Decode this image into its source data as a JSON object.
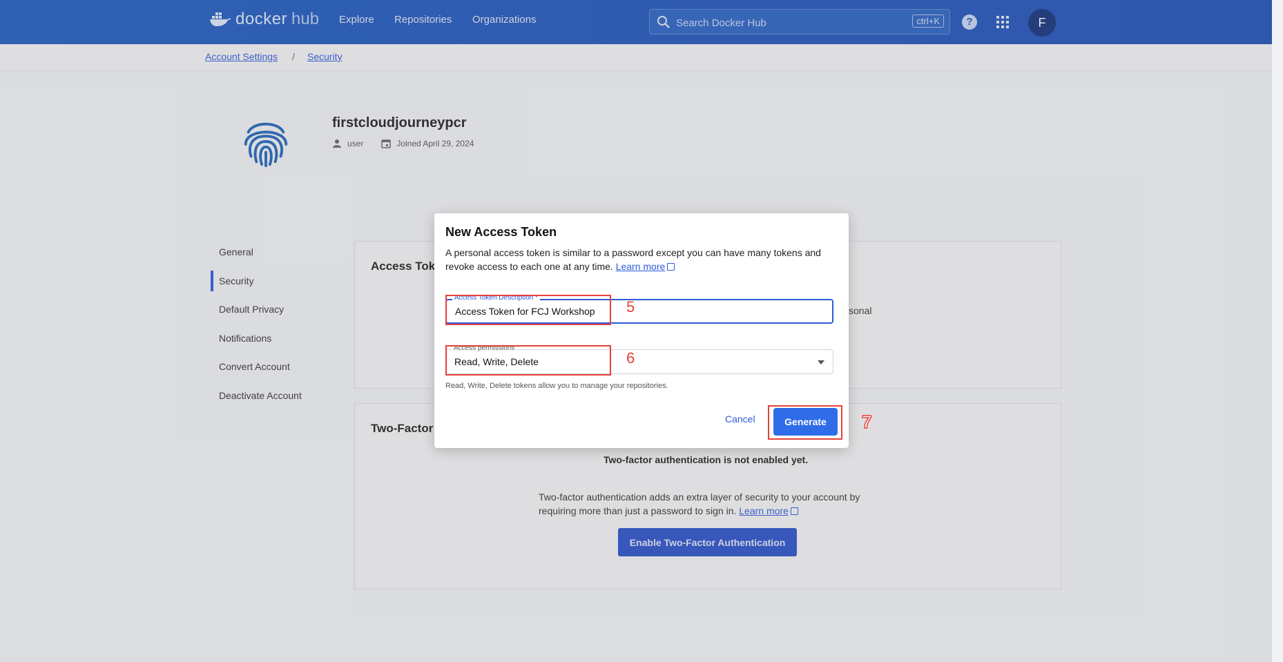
{
  "nav": {
    "brand": "docker",
    "brand_suffix": "hub",
    "links": [
      "Explore",
      "Repositories",
      "Organizations"
    ],
    "search_placeholder": "Search Docker Hub",
    "search_shortcut": "ctrl+K",
    "help_glyph": "?",
    "avatar_initial": "F"
  },
  "breadcrumb": {
    "items": [
      "Account Settings",
      "Security"
    ],
    "separator": "/"
  },
  "profile": {
    "username": "firstcloudjourneypcr",
    "role": "user",
    "joined": "Joined April 29, 2024"
  },
  "sidebar": {
    "items": [
      "General",
      "Security",
      "Default Privacy",
      "Notifications",
      "Convert Account",
      "Deactivate Account"
    ],
    "active": "Security"
  },
  "cards": {
    "access_tokens_title": "Access Toke",
    "access_tokens_partial": "sonal",
    "twofa_title": "Two-Factor",
    "twofa_status": "Two-factor authentication is not enabled yet.",
    "twofa_desc": "Two-factor authentication adds an extra layer of security to your account by requiring more than just a password to sign in.",
    "learn_more": "Learn more",
    "enable_button": "Enable Two-Factor Authentication"
  },
  "modal": {
    "title": "New Access Token",
    "description": "A personal access token is similar to a password except you can have many tokens and revoke access to each one at any time.",
    "learn_more": "Learn more",
    "desc_label": "Access Token Description *",
    "desc_value": "Access Token for FCJ Workshop",
    "perm_label": "Access permissions",
    "perm_value": "Read, Write, Delete",
    "perm_help": "Read, Write, Delete tokens allow you to manage your repositories.",
    "cancel": "Cancel",
    "generate": "Generate"
  },
  "annotations": {
    "a5": "5",
    "a6": "6",
    "a7": "7",
    "color": "#e8403a"
  },
  "colors": {
    "topbar": "#1f55bc",
    "primary": "#2f6ce8",
    "link": "#2d5bd8"
  },
  "icons": [
    "docker-whale-icon",
    "search-icon",
    "help-icon",
    "apps-grid-icon",
    "fingerprint-icon",
    "user-icon",
    "calendar-icon",
    "external-link-icon",
    "chevron-down-icon"
  ]
}
